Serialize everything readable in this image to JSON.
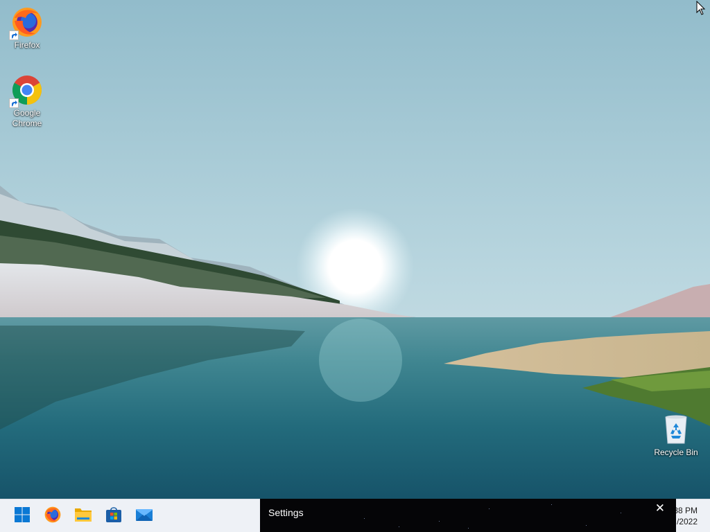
{
  "desktop": {
    "icons": [
      {
        "label": "Firefox",
        "icon": "firefox-icon"
      },
      {
        "label": "Google Chrome",
        "icon": "chrome-icon"
      },
      {
        "label": "Recycle Bin",
        "icon": "recycle-bin-icon"
      }
    ]
  },
  "taskbar": {
    "buttons": [
      {
        "icon": "windows-start-icon"
      },
      {
        "icon": "firefox-icon"
      },
      {
        "icon": "file-explorer-icon"
      },
      {
        "icon": "microsoft-store-icon"
      },
      {
        "icon": "mail-icon"
      }
    ],
    "clock": {
      "time": "38 PM",
      "date": "/2022"
    }
  },
  "toast": {
    "title": "Settings",
    "close_glyph": "✕"
  },
  "colors": {
    "taskbar_bg": "#eef1f6",
    "toast_bg": "#050507",
    "windows_blue": "#0a78d4"
  }
}
